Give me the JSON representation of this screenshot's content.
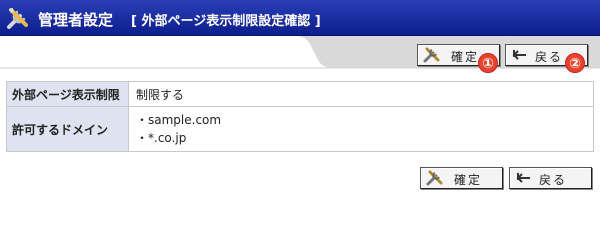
{
  "header": {
    "title": "管理者設定",
    "subtitle": "[ 外部ページ表示制限設定確認 ]"
  },
  "toolbar": {
    "confirm_label": "確定",
    "back_label": "戻る",
    "callout_confirm": "①",
    "callout_back": "②"
  },
  "settings": {
    "restriction_label": "外部ページ表示制限",
    "restriction_value": "制限する",
    "domains_label": "許可するドメイン",
    "domains": [
      "・sample.com",
      "・*.co.jp"
    ]
  },
  "footer": {
    "confirm_label": "確定",
    "back_label": "戻る"
  },
  "colors": {
    "titlebar": "#1a2ea0",
    "label_cell": "#dfe3f1",
    "callout": "#e8432b"
  },
  "icons": {
    "title": "tools-icon",
    "confirm": "tools-icon",
    "back": "return-arrow-icon"
  }
}
